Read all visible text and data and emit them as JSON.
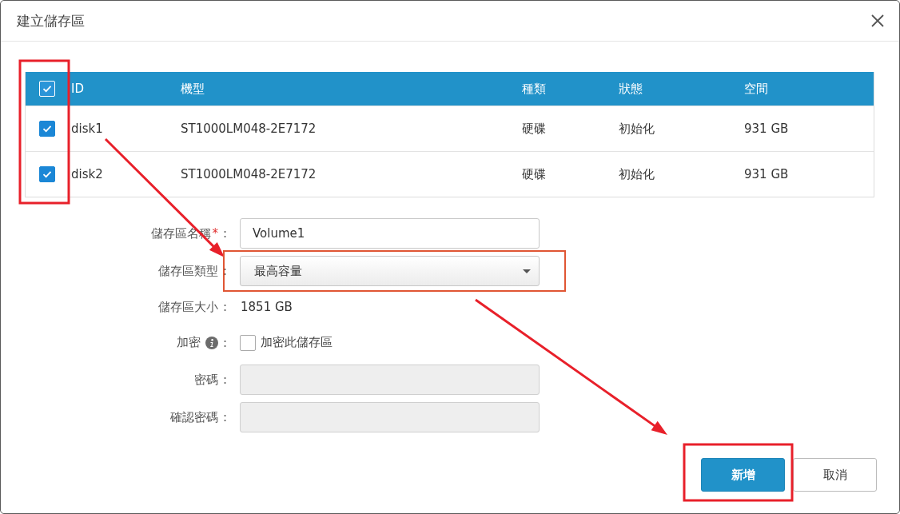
{
  "dialog": {
    "title": "建立儲存區"
  },
  "table": {
    "select_all": {
      "checked": true
    },
    "columns": [
      "ID",
      "機型",
      "種類",
      "狀態",
      "空間"
    ],
    "rows": [
      {
        "checked": true,
        "cells": [
          "disk1",
          "ST1000LM048-2E7172",
          "硬碟",
          "初始化",
          "931 GB"
        ]
      },
      {
        "checked": true,
        "cells": [
          "disk2",
          "ST1000LM048-2E7172",
          "硬碟",
          "初始化",
          "931 GB"
        ]
      }
    ]
  },
  "form": {
    "fields": [
      {
        "kind": "text",
        "label": "儲存區名稱",
        "required_mark": "*",
        "separator": ":",
        "value": "Volume1"
      },
      {
        "kind": "select",
        "label": "儲存區類型",
        "separator": ":",
        "value": "最高容量"
      },
      {
        "kind": "static",
        "label": "儲存區大小",
        "separator": ":",
        "value": "1851 GB"
      },
      {
        "kind": "checkbox",
        "label": "加密",
        "info": true,
        "separator": ":",
        "checked": false,
        "option": "加密此儲存區"
      },
      {
        "kind": "password",
        "label": "密碼",
        "separator": ":",
        "disabled": true
      },
      {
        "kind": "password",
        "label": "確認密碼",
        "separator": ":",
        "disabled": true
      }
    ]
  },
  "buttons": [
    {
      "kind": "primary",
      "label": "新增"
    },
    {
      "kind": "secondary",
      "label": "取消"
    }
  ],
  "annotations": [
    {
      "kind": "frame",
      "color": "#e8202a"
    },
    {
      "kind": "arrow",
      "color": "#e8202a"
    },
    {
      "kind": "frame",
      "color": "#e05634"
    },
    {
      "kind": "arrow",
      "color": "#e8202a"
    },
    {
      "kind": "frame",
      "color": "#e8202a"
    }
  ]
}
